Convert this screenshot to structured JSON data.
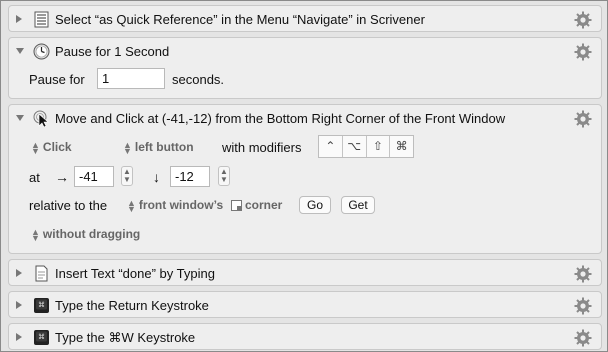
{
  "actions": [
    {
      "title": "Select “as Quick Reference” in the Menu “Navigate” in Scrivener",
      "icon": "menu-list-icon"
    },
    {
      "title": "Pause for 1 Second",
      "icon": "clock-icon",
      "pause_label": "Pause for",
      "seconds_value": "1",
      "seconds_label": "seconds."
    },
    {
      "title": "Move and Click at (-41,-12) from the Bottom Right Corner of the Front Window",
      "icon": "mouse-click-icon",
      "click_type": "Click",
      "button": "left button",
      "with_modifiers_label": "with modifiers",
      "modifiers": [
        "⌃",
        "⌥",
        "⇧",
        "⌘"
      ],
      "at_label": "at",
      "x_arrow": "→",
      "x_value": "-41",
      "y_arrow": "↓",
      "y_value": "-12",
      "relative_label": "relative to the",
      "relative_target": "front window’s",
      "corner_label": "corner",
      "go_label": "Go",
      "get_label": "Get",
      "drag_option": "without dragging"
    },
    {
      "title": "Insert Text “done” by Typing",
      "icon": "document-text-icon"
    },
    {
      "title": "Type the Return Keystroke",
      "icon": "keystroke-icon"
    },
    {
      "title": "Type the ⌘W Keystroke",
      "icon": "keystroke-icon"
    }
  ]
}
